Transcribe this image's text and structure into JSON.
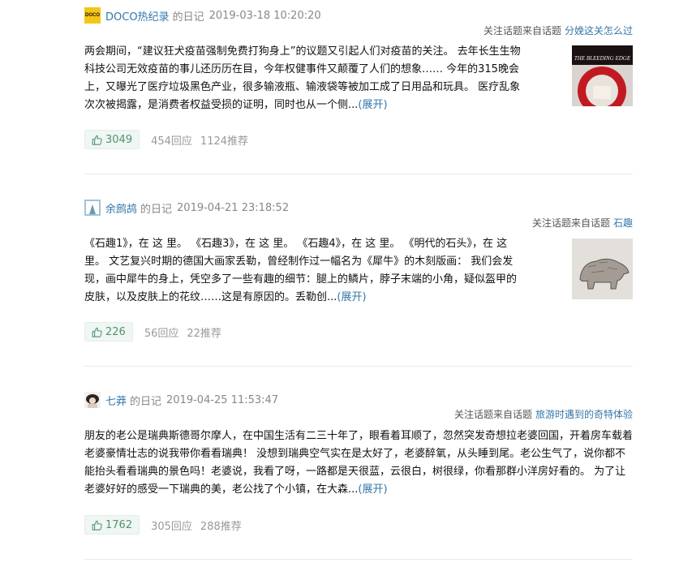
{
  "items": [
    {
      "author": "DOCO热纪录",
      "diary_label": "的日记",
      "date": "2019-03-18 10:20:20",
      "topic_prefix": "关注话题来自话题",
      "topic": "分娩这关怎么过",
      "excerpt": "两会期间，“建议狂犬疫苗强制免费打狗身上”的议题又引起人们对疫苗的关注。 去年长生生物科技公司无效疫苗的事儿还历历在目，今年权健事件又颠覆了人们的想象…… 今年的315晚会上，又曝光了医疗垃圾黑色产业，很多输液瓶、输液袋等被加工成了日用品和玩具。 医疗乱象次次被揭露，是消费者权益受损的证明，同时也从一个侧...",
      "expand": "(展开)",
      "likes": "3049",
      "replies": "454回应",
      "recs": "1124推荐",
      "avatar_text": "DOCO",
      "thumb_text": "THE BLEEDING EDGE"
    },
    {
      "author": "余鹧鸪",
      "diary_label": "的日记",
      "date": "2019-04-21 23:18:52",
      "topic_prefix": "关注话题来自话题",
      "topic": "石趣",
      "excerpt": "《石趣1》，在 这 里。 《石趣3》，在 这 里。 《石趣4》，在 这 里。 《明代的石头》，在 这 里。 文艺复兴时期的德国大画家丢勒，曾经制作过一幅名为《犀牛》的木刻版画： 我们会发现，画中犀牛的身上，凭空多了一些有趣的细节：腿上的鳞片，脖子末端的小角，疑似盔甲的皮肤，以及皮肤上的花纹……这是有原因的。丢勒创...",
      "expand": "(展开)",
      "likes": "226",
      "replies": "56回应",
      "recs": "22推荐"
    },
    {
      "author": "七莽",
      "diary_label": "的日记",
      "date": "2019-04-25 11:53:47",
      "topic_prefix": "关注话题来自话题",
      "topic": "旅游时遇到的奇特体验",
      "excerpt": "朋友的老公是瑞典斯德哥尔摩人，在中国生活有二三十年了，眼看着耳顺了，忽然突发奇想拉老婆回国，开着房车载着老婆豪情壮志的说我带你看看瑞典！ 没想到瑞典空气实在是太好了，老婆醉氧，从头睡到尾。老公生气了，说你都不能抬头看看瑞典的景色吗！老婆说，我看了呀，一路都是天很蓝，云很白，树很绿，你看那群小洋房好看的。 为了让老婆好好的感受一下瑞典的美，老公找了个小镇，在大森...",
      "expand": "(展开)",
      "likes": "1762",
      "replies": "305回应",
      "recs": "288推荐"
    }
  ],
  "colors": {
    "link": "#3377aa",
    "like_green": "#4f946e",
    "muted": "#888888"
  },
  "icons": {
    "like": "thumbs-up-icon"
  }
}
